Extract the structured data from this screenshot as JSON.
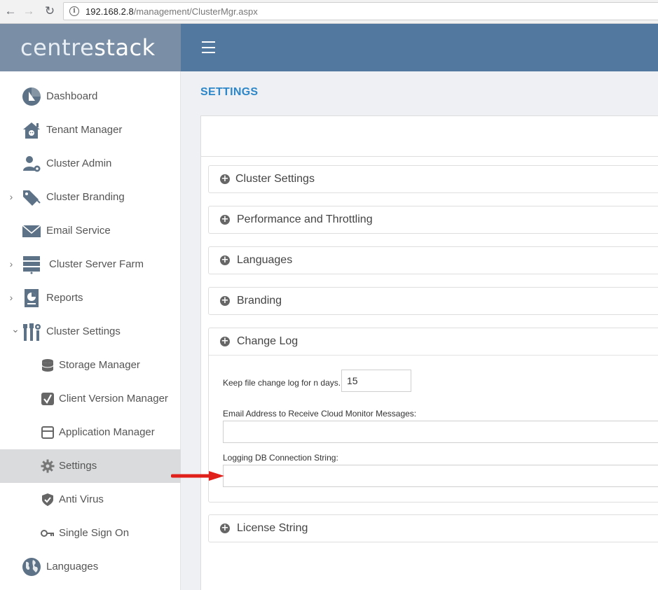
{
  "browser": {
    "url_host": "192.168.2.8",
    "url_path": "/management/ClusterMgr.aspx"
  },
  "brand": {
    "part1": "centre",
    "part2": "stack"
  },
  "colors": {
    "brand_bg": "#7a8fa6",
    "topbar_bg": "#53789f",
    "title_blue": "#2d87c8",
    "arrow_red": "#e0201b"
  },
  "sidebar": {
    "items": [
      {
        "label": "Dashboard",
        "icon": "dashboard-icon"
      },
      {
        "label": "Tenant Manager",
        "icon": "tenant-house-icon"
      },
      {
        "label": "Cluster Admin",
        "icon": "user-gear-icon"
      },
      {
        "label": "Cluster Branding",
        "icon": "tags-icon",
        "caret": "›"
      },
      {
        "label": "Email Service",
        "icon": "envelope-icon"
      },
      {
        "label": "Cluster Server Farm",
        "icon": "server-rack-icon",
        "caret": "›"
      },
      {
        "label": "Reports",
        "icon": "report-icon",
        "caret": "›"
      },
      {
        "label": "Cluster Settings",
        "icon": "tools-icon",
        "caret": "⌄"
      }
    ],
    "subitems": [
      {
        "label": "Storage Manager",
        "icon": "database-icon"
      },
      {
        "label": "Client Version Manager",
        "icon": "check-square-icon"
      },
      {
        "label": "Application Manager",
        "icon": "window-icon"
      },
      {
        "label": "Settings",
        "icon": "gear-icon"
      },
      {
        "label": "Anti Virus",
        "icon": "shield-check-icon"
      },
      {
        "label": "Single Sign On",
        "icon": "key-icon"
      }
    ],
    "bottom": {
      "label": "Languages",
      "icon": "globe-icon"
    }
  },
  "main": {
    "title": "SETTINGS",
    "panels": [
      {
        "title": "Cluster Settings"
      },
      {
        "title": "Performance and Throttling"
      },
      {
        "title": "Languages"
      },
      {
        "title": "Branding"
      },
      {
        "title": "Change Log"
      },
      {
        "title": "License String"
      }
    ],
    "change_log": {
      "keep_days_label": "Keep file change log for n days.",
      "keep_days_value": "15",
      "email_label": "Email Address to Receive Cloud Monitor Messages:",
      "email_value": "",
      "db_label": "Logging DB Connection String:",
      "db_value": ""
    }
  }
}
